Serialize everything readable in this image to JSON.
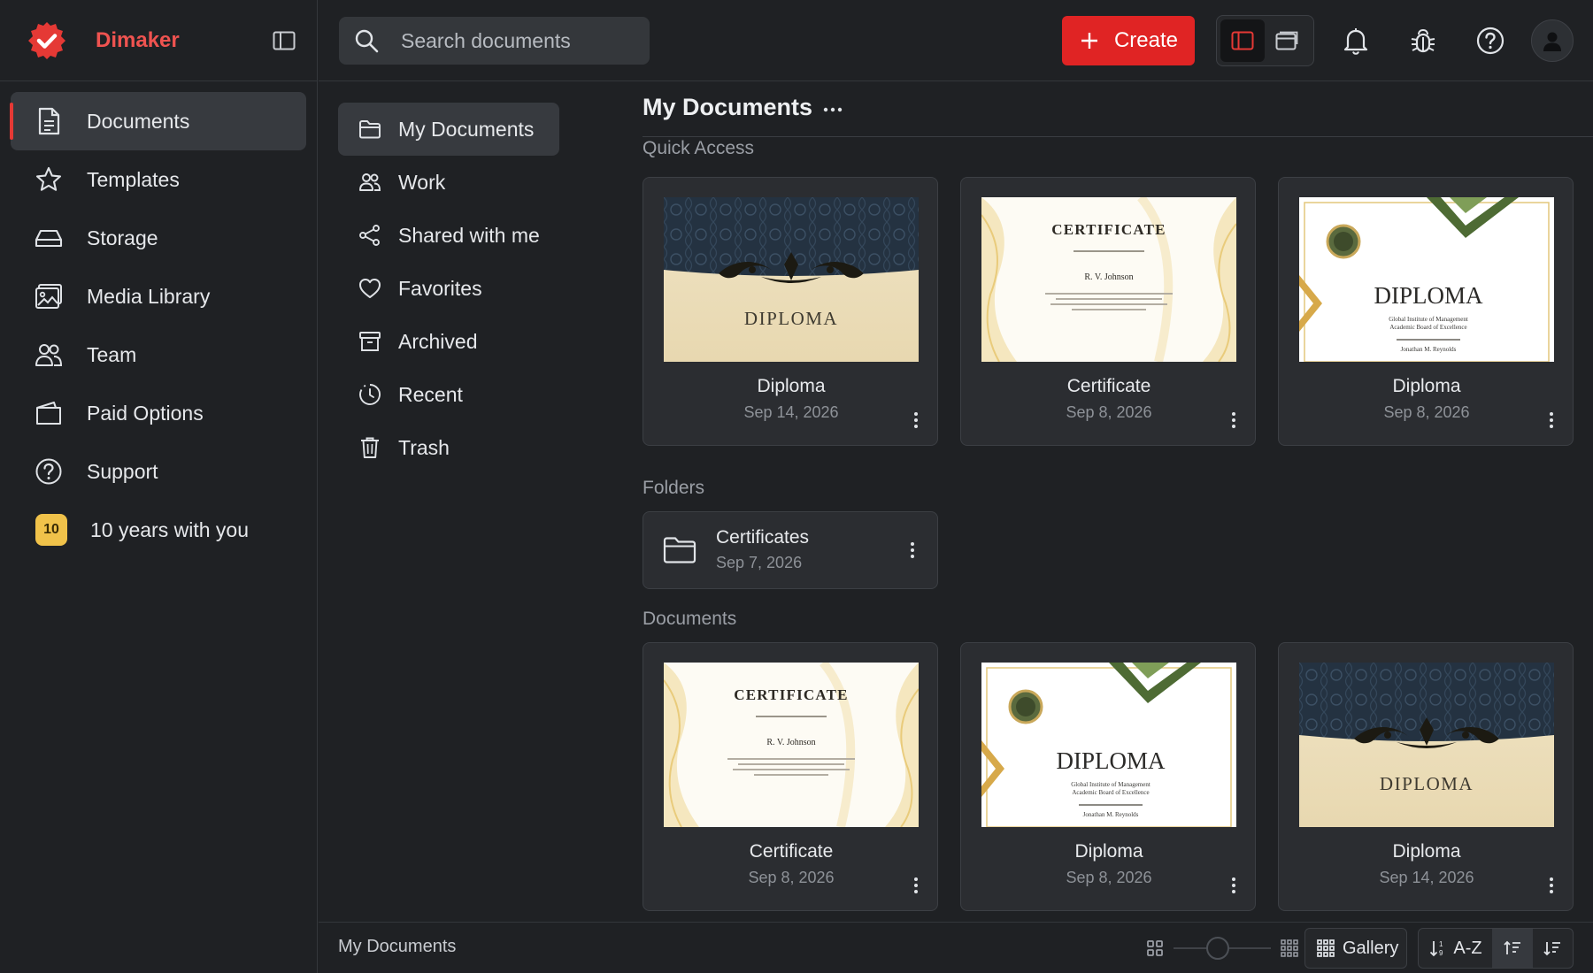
{
  "app": {
    "brand": "Dimaker",
    "accent": "#e02424"
  },
  "sidebar": {
    "items": [
      {
        "label": "Documents",
        "icon": "document-icon",
        "active": true
      },
      {
        "label": "Templates",
        "icon": "star-icon"
      },
      {
        "label": "Storage",
        "icon": "storage-icon"
      },
      {
        "label": "Media Library",
        "icon": "image-icon"
      },
      {
        "label": "Team",
        "icon": "team-icon"
      },
      {
        "label": "Paid Options",
        "icon": "wallet-icon"
      },
      {
        "label": "Support",
        "icon": "help-icon"
      }
    ],
    "anniversary": {
      "badge": "10",
      "label": "10 years with you"
    }
  },
  "topbar": {
    "search_placeholder": "Search documents",
    "create_label": "Create"
  },
  "folder_nav": {
    "items": [
      {
        "label": "My Documents",
        "icon": "folder-open-icon",
        "active": true
      },
      {
        "label": "Work",
        "icon": "group-icon"
      },
      {
        "label": "Shared with me",
        "icon": "share-icon"
      },
      {
        "label": "Favorites",
        "icon": "heart-icon"
      },
      {
        "label": "Archived",
        "icon": "archive-icon"
      },
      {
        "label": "Recent",
        "icon": "clock-icon"
      },
      {
        "label": "Trash",
        "icon": "trash-icon"
      }
    ]
  },
  "main": {
    "title": "My Documents",
    "quick_access": {
      "label": "Quick Access",
      "cards": [
        {
          "name": "Diploma",
          "date": "Sep 14, 2026",
          "thumb": "diploma-dark",
          "thumb_title": "DIPLOMA"
        },
        {
          "name": "Certificate",
          "date": "Sep 8, 2026",
          "thumb": "certificate-gold",
          "thumb_title": "CERTIFICATE",
          "thumb_person": "R. V. Johnson"
        },
        {
          "name": "Diploma",
          "date": "Sep 8, 2026",
          "thumb": "diploma-green",
          "thumb_title": "DIPLOMA",
          "thumb_sub": "Global Institute of Management",
          "thumb_sub2": "Academic Board of Excellence",
          "thumb_person": "Jonathan M. Reynolds"
        }
      ]
    },
    "folders": {
      "label": "Folders",
      "items": [
        {
          "name": "Certificates",
          "date": "Sep 7, 2026"
        }
      ]
    },
    "documents": {
      "label": "Documents",
      "cards": [
        {
          "name": "Certificate",
          "date": "Sep 8, 2026",
          "thumb": "certificate-gold",
          "thumb_title": "CERTIFICATE",
          "thumb_person": "R. V. Johnson"
        },
        {
          "name": "Diploma",
          "date": "Sep 8, 2026",
          "thumb": "diploma-green",
          "thumb_title": "DIPLOMA",
          "thumb_sub": "Global Institute of Management",
          "thumb_sub2": "Academic Board of Excellence",
          "thumb_person": "Jonathan M. Reynolds"
        },
        {
          "name": "Diploma",
          "date": "Sep 14, 2026",
          "thumb": "diploma-dark",
          "thumb_title": "DIPLOMA"
        }
      ]
    }
  },
  "bottombar": {
    "breadcrumb": "My Documents",
    "zoom_level": 0.45,
    "view_label": "Gallery",
    "sort_label": "A-Z"
  }
}
